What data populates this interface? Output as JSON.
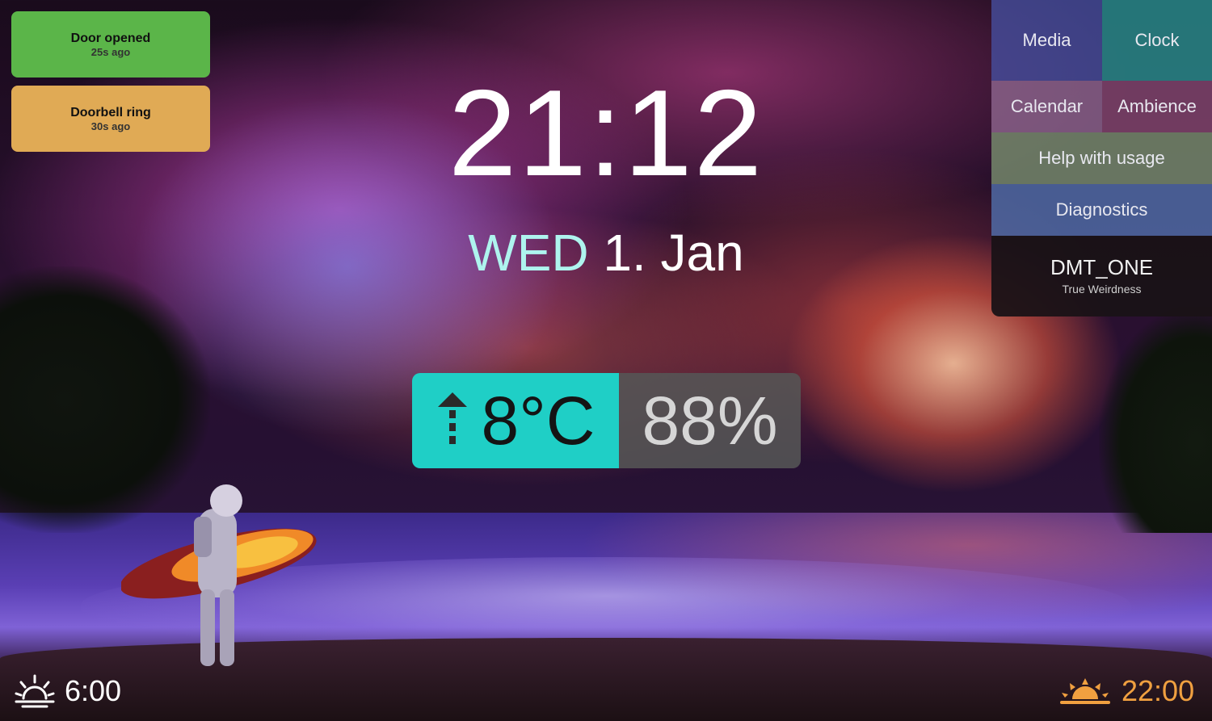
{
  "notifications": [
    {
      "title": "Door opened",
      "ago": "25s ago",
      "color": "#5bb549"
    },
    {
      "title": "Doorbell ring",
      "ago": "30s ago",
      "color": "#e0aa55"
    }
  ],
  "clock": {
    "time": "21:12",
    "weekday": "WED",
    "date": "1. Jan"
  },
  "weather": {
    "trend_icon": "arrow-up-dashed-icon",
    "temperature": "8°C",
    "humidity": "88%",
    "temp_color": "#1fcfc6"
  },
  "menu": {
    "media": "Media",
    "clock": "Clock",
    "calendar": "Calendar",
    "ambience": "Ambience",
    "help": "Help with usage",
    "diagnostics": "Diagnostics",
    "user_name": "DMT_ONE",
    "user_subtitle": "True Weirdness"
  },
  "sun": {
    "sunrise": "6:00",
    "sunrise_icon": "sunrise-icon",
    "sunset": "22:00",
    "sunset_icon": "sunset-icon",
    "sunset_color": "#f0a040"
  }
}
